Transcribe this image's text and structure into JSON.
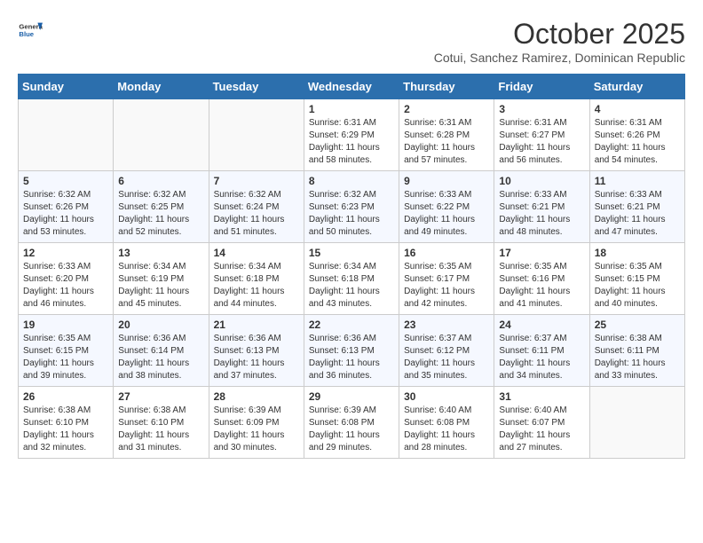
{
  "header": {
    "logo": {
      "general": "General",
      "blue": "Blue"
    },
    "title": "October 2025",
    "subtitle": "Cotui, Sanchez Ramirez, Dominican Republic"
  },
  "calendar": {
    "weekdays": [
      "Sunday",
      "Monday",
      "Tuesday",
      "Wednesday",
      "Thursday",
      "Friday",
      "Saturday"
    ],
    "weeks": [
      [
        {
          "day": "",
          "info": ""
        },
        {
          "day": "",
          "info": ""
        },
        {
          "day": "",
          "info": ""
        },
        {
          "day": "1",
          "sunrise": "6:31 AM",
          "sunset": "6:29 PM",
          "daylight": "11 hours and 58 minutes."
        },
        {
          "day": "2",
          "sunrise": "6:31 AM",
          "sunset": "6:28 PM",
          "daylight": "11 hours and 57 minutes."
        },
        {
          "day": "3",
          "sunrise": "6:31 AM",
          "sunset": "6:27 PM",
          "daylight": "11 hours and 56 minutes."
        },
        {
          "day": "4",
          "sunrise": "6:31 AM",
          "sunset": "6:26 PM",
          "daylight": "11 hours and 54 minutes."
        }
      ],
      [
        {
          "day": "5",
          "sunrise": "6:32 AM",
          "sunset": "6:26 PM",
          "daylight": "11 hours and 53 minutes."
        },
        {
          "day": "6",
          "sunrise": "6:32 AM",
          "sunset": "6:25 PM",
          "daylight": "11 hours and 52 minutes."
        },
        {
          "day": "7",
          "sunrise": "6:32 AM",
          "sunset": "6:24 PM",
          "daylight": "11 hours and 51 minutes."
        },
        {
          "day": "8",
          "sunrise": "6:32 AM",
          "sunset": "6:23 PM",
          "daylight": "11 hours and 50 minutes."
        },
        {
          "day": "9",
          "sunrise": "6:33 AM",
          "sunset": "6:22 PM",
          "daylight": "11 hours and 49 minutes."
        },
        {
          "day": "10",
          "sunrise": "6:33 AM",
          "sunset": "6:21 PM",
          "daylight": "11 hours and 48 minutes."
        },
        {
          "day": "11",
          "sunrise": "6:33 AM",
          "sunset": "6:21 PM",
          "daylight": "11 hours and 47 minutes."
        }
      ],
      [
        {
          "day": "12",
          "sunrise": "6:33 AM",
          "sunset": "6:20 PM",
          "daylight": "11 hours and 46 minutes."
        },
        {
          "day": "13",
          "sunrise": "6:34 AM",
          "sunset": "6:19 PM",
          "daylight": "11 hours and 45 minutes."
        },
        {
          "day": "14",
          "sunrise": "6:34 AM",
          "sunset": "6:18 PM",
          "daylight": "11 hours and 44 minutes."
        },
        {
          "day": "15",
          "sunrise": "6:34 AM",
          "sunset": "6:18 PM",
          "daylight": "11 hours and 43 minutes."
        },
        {
          "day": "16",
          "sunrise": "6:35 AM",
          "sunset": "6:17 PM",
          "daylight": "11 hours and 42 minutes."
        },
        {
          "day": "17",
          "sunrise": "6:35 AM",
          "sunset": "6:16 PM",
          "daylight": "11 hours and 41 minutes."
        },
        {
          "day": "18",
          "sunrise": "6:35 AM",
          "sunset": "6:15 PM",
          "daylight": "11 hours and 40 minutes."
        }
      ],
      [
        {
          "day": "19",
          "sunrise": "6:35 AM",
          "sunset": "6:15 PM",
          "daylight": "11 hours and 39 minutes."
        },
        {
          "day": "20",
          "sunrise": "6:36 AM",
          "sunset": "6:14 PM",
          "daylight": "11 hours and 38 minutes."
        },
        {
          "day": "21",
          "sunrise": "6:36 AM",
          "sunset": "6:13 PM",
          "daylight": "11 hours and 37 minutes."
        },
        {
          "day": "22",
          "sunrise": "6:36 AM",
          "sunset": "6:13 PM",
          "daylight": "11 hours and 36 minutes."
        },
        {
          "day": "23",
          "sunrise": "6:37 AM",
          "sunset": "6:12 PM",
          "daylight": "11 hours and 35 minutes."
        },
        {
          "day": "24",
          "sunrise": "6:37 AM",
          "sunset": "6:11 PM",
          "daylight": "11 hours and 34 minutes."
        },
        {
          "day": "25",
          "sunrise": "6:38 AM",
          "sunset": "6:11 PM",
          "daylight": "11 hours and 33 minutes."
        }
      ],
      [
        {
          "day": "26",
          "sunrise": "6:38 AM",
          "sunset": "6:10 PM",
          "daylight": "11 hours and 32 minutes."
        },
        {
          "day": "27",
          "sunrise": "6:38 AM",
          "sunset": "6:10 PM",
          "daylight": "11 hours and 31 minutes."
        },
        {
          "day": "28",
          "sunrise": "6:39 AM",
          "sunset": "6:09 PM",
          "daylight": "11 hours and 30 minutes."
        },
        {
          "day": "29",
          "sunrise": "6:39 AM",
          "sunset": "6:08 PM",
          "daylight": "11 hours and 29 minutes."
        },
        {
          "day": "30",
          "sunrise": "6:40 AM",
          "sunset": "6:08 PM",
          "daylight": "11 hours and 28 minutes."
        },
        {
          "day": "31",
          "sunrise": "6:40 AM",
          "sunset": "6:07 PM",
          "daylight": "11 hours and 27 minutes."
        },
        {
          "day": "",
          "info": ""
        }
      ]
    ]
  }
}
